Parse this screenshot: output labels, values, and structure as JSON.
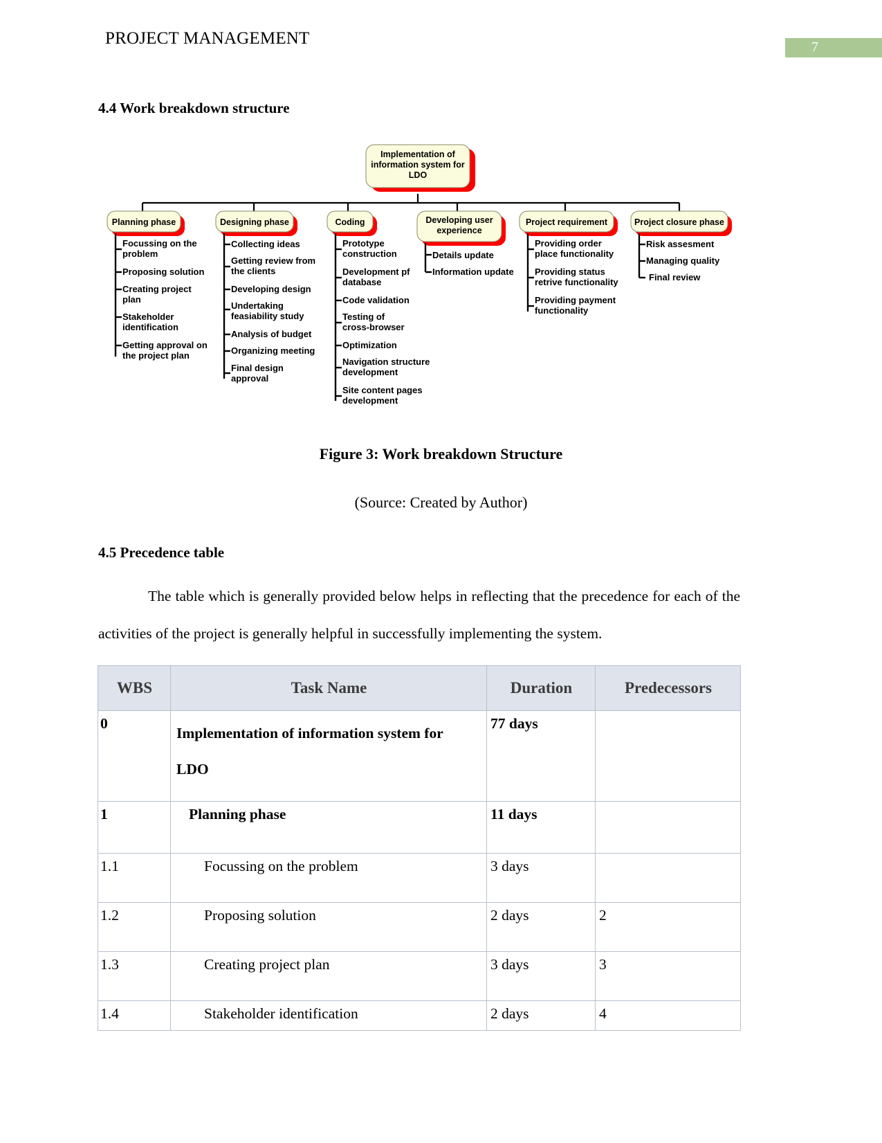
{
  "header": {
    "title": "PROJECT MANAGEMENT",
    "page_number": "7",
    "band_color": "#a9c893"
  },
  "sections": {
    "h_44": "4.4 Work breakdown structure",
    "h_45": "4.5 Precedence table"
  },
  "figure": {
    "caption": "Figure 3: Work breakdown Structure",
    "source": "(Source: Created by Author)"
  },
  "paragraph": "The table which is generally provided below helps in reflecting that the precedence for each of the activities of the project is generally helpful in successfully implementing the system.",
  "wbs": {
    "node_fill": "#fbfbdd",
    "node_shadow": "#fe0000",
    "node_stroke": "#8a8a6a",
    "connector_color": "#000000",
    "root": "Implementation of information system for LDO",
    "root_lines": [
      "Implementation of",
      "information system for",
      "LDO"
    ],
    "branches": [
      {
        "title": "Planning phase",
        "children": [
          [
            "Focussing on the",
            "problem"
          ],
          [
            "Proposing solution"
          ],
          [
            "Creating project",
            "plan"
          ],
          [
            "Stakeholder",
            "identification"
          ],
          [
            "Getting approval on",
            "the project plan"
          ]
        ]
      },
      {
        "title": "Designing phase",
        "children": [
          [
            "Collecting ideas"
          ],
          [
            "Getting review from",
            "the clients"
          ],
          [
            "Developing design"
          ],
          [
            "Undertaking",
            "feasiability study"
          ],
          [
            "Analysis of budget"
          ],
          [
            "Organizing meeting"
          ],
          [
            "Final design",
            "approval"
          ]
        ]
      },
      {
        "title": "Coding",
        "children": [
          [
            "Prototype",
            "construction"
          ],
          [
            "Development pf",
            "database"
          ],
          [
            "Code validation"
          ],
          [
            "Testing of",
            "cross-browser"
          ],
          [
            "Optimization"
          ],
          [
            "Navigation structure",
            "development"
          ],
          [
            "Site content pages",
            "development"
          ]
        ]
      },
      {
        "title": "Developing user experience",
        "title_lines": [
          "Developing user",
          "experience"
        ],
        "children": [
          [
            "Details update"
          ],
          [
            "Information update"
          ]
        ]
      },
      {
        "title": "Project requirement",
        "children": [
          [
            "Providing order",
            "place functionality"
          ],
          [
            "Providing status",
            "retrive functionality"
          ],
          [
            "Providing payment",
            "functionality"
          ]
        ]
      },
      {
        "title": "Project closure phase",
        "children": [
          [
            "Risk assesment"
          ],
          [
            "Managing quality"
          ],
          [
            "Final review"
          ]
        ]
      }
    ]
  },
  "table": {
    "headers": [
      "WBS",
      "Task Name",
      "Duration",
      "Predecessors"
    ],
    "header_bg": "#dfe3ec",
    "rows": [
      {
        "wbs": "0",
        "task": "Implementation of information system for",
        "task2": "LDO",
        "duration": "77 days",
        "predecessors": "",
        "bold": true,
        "style": "root"
      },
      {
        "wbs": "1",
        "task": "Planning phase",
        "duration": "11 days",
        "predecessors": "",
        "bold": true,
        "style": "phase"
      },
      {
        "wbs": "1.1",
        "task": "Focussing on the problem",
        "duration": "3 days",
        "predecessors": "",
        "bold": false,
        "style": "std"
      },
      {
        "wbs": "1.2",
        "task": "Proposing solution",
        "duration": "2 days",
        "predecessors": "2",
        "bold": false,
        "style": "std"
      },
      {
        "wbs": "1.3",
        "task": "Creating project plan",
        "duration": "3 days",
        "predecessors": "3",
        "bold": false,
        "style": "std"
      },
      {
        "wbs": "1.4",
        "task": "Stakeholder identification",
        "duration": "2 days",
        "predecessors": "4",
        "bold": false,
        "style": "last"
      }
    ]
  }
}
